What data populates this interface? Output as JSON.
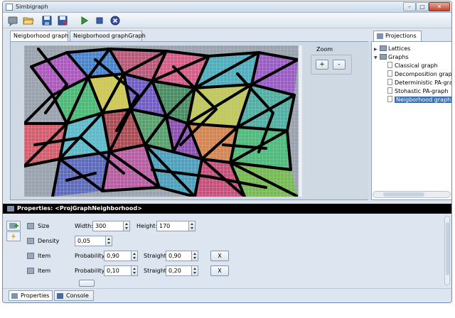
{
  "window": {
    "title": "Simbigraph",
    "controls": [
      "–",
      "□",
      "✕"
    ]
  },
  "toolbar": {
    "buttons": [
      {
        "name": "new-icon",
        "color": "#6b7a8c"
      },
      {
        "name": "open-icon",
        "color": "#e0b040"
      },
      {
        "name": "save-icon",
        "color": "#2f5fa8"
      },
      {
        "name": "save-as-icon",
        "color": "#2f5fa8"
      },
      {
        "name": "run-icon",
        "color": "#2d9a3a"
      },
      {
        "name": "stop-icon",
        "color": "#3a5fb0"
      },
      {
        "name": "stop-circle-icon",
        "color": "#3a4fa0"
      }
    ]
  },
  "tabs": [
    "Neigborhood graph",
    "Neigborhood graphGraph"
  ],
  "zoom": {
    "label": "Zoom",
    "plus": "+",
    "minus": "-"
  },
  "projections": {
    "tab": "Projections",
    "tree": [
      {
        "label": "Lattices",
        "type": "folder",
        "level": 0,
        "expanded": false
      },
      {
        "label": "Graphs",
        "type": "folder",
        "level": 0,
        "expanded": true
      },
      {
        "label": "Classical graph",
        "type": "doc",
        "level": 1
      },
      {
        "label": "Decomposition graph",
        "type": "doc",
        "level": 1
      },
      {
        "label": "Deterministic PA-grapt",
        "type": "doc",
        "level": 1
      },
      {
        "label": "Stohastic PA-graph",
        "type": "doc",
        "level": 1
      },
      {
        "label": "Neigborhood graph",
        "type": "doc",
        "level": 1,
        "selected": true
      }
    ]
  },
  "properties": {
    "header": "Properties: <ProjGraphNeighborhood>",
    "size": {
      "label": "Size",
      "width_label": "Width:",
      "width": "300",
      "height_label": "Height:",
      "height": "170"
    },
    "density": {
      "label": "Density",
      "value": "0,05"
    },
    "items": [
      {
        "label": "Item",
        "prob_label": "Probability:",
        "prob": "0,90",
        "straight_label": "Straight:",
        "straight": "0,90",
        "remove": "X"
      },
      {
        "label": "Item",
        "prob_label": "Probability:",
        "prob": "0,10",
        "straight_label": "Straight:",
        "straight": "0,20",
        "remove": "X"
      }
    ]
  },
  "bottom_tabs": [
    "Properties",
    "Console"
  ],
  "colors": {
    "selection": "#3b6fb6",
    "header": "#000000",
    "panel": "#dde6f0"
  }
}
